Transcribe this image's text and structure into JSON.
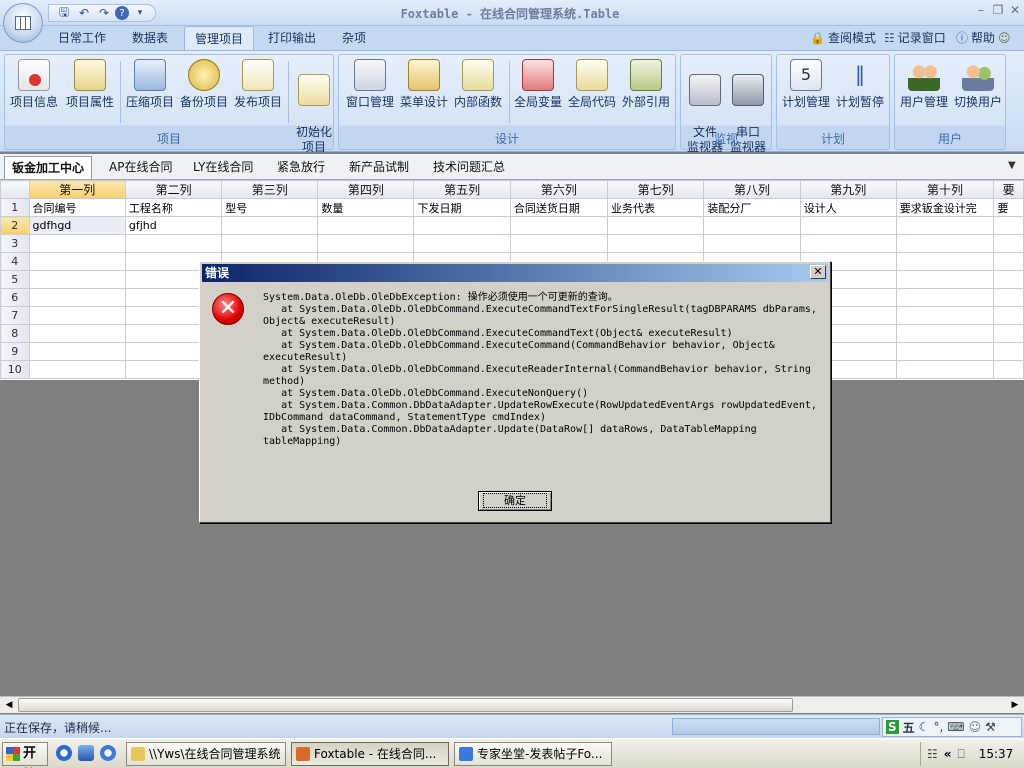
{
  "window": {
    "title": "Foxtable - 在线合同管理系统.Table"
  },
  "qat": {
    "icons": [
      "save-icon",
      "undo-icon",
      "redo-icon",
      "help-icon",
      "dropdown-icon"
    ]
  },
  "tabs": [
    "日常工作",
    "数据表",
    "管理项目",
    "打印输出",
    "杂项"
  ],
  "active_tab": "管理项目",
  "right_links": {
    "view_mode": "查阅模式",
    "log_window": "记录窗口",
    "help": "帮助"
  },
  "ribbon": {
    "groups": [
      {
        "label": "项目",
        "buttons": [
          "项目信息",
          "项目属性",
          "压缩项目",
          "备份项目",
          "发布项目",
          "初始化\n项目"
        ]
      },
      {
        "label": "设计",
        "buttons": [
          "窗口管理",
          "菜单设计",
          "内部函数",
          "全局变量",
          "全局代码",
          "外部引用"
        ]
      },
      {
        "label": "监视",
        "buttons": [
          "文件\n监视器",
          "串口\n监视器"
        ]
      },
      {
        "label": "计划",
        "buttons": [
          "计划管理",
          "计划暂停"
        ]
      },
      {
        "label": "用户",
        "buttons": [
          "用户管理",
          "切换用户"
        ]
      }
    ]
  },
  "doc_tabs": [
    "钣金加工中心",
    "AP在线合同",
    "LY在线合同",
    "紧急放行",
    "新产品试制",
    "技术问题汇总"
  ],
  "active_doc_tab": "钣金加工中心",
  "grid": {
    "columns": [
      "第一列",
      "第二列",
      "第三列",
      "第四列",
      "第五列",
      "第六列",
      "第七列",
      "第八列",
      "第九列",
      "第十列",
      "要"
    ],
    "rows": [
      [
        "合同编号",
        "工程名称",
        "型号",
        "数量",
        "下发日期",
        "合同送货日期",
        "业务代表",
        "装配分厂",
        "设计人",
        "要求钣金设计完",
        "要"
      ],
      [
        "gdfhgd",
        "gfjhd",
        "",
        "",
        "",
        "",
        "",
        "",
        "",
        "",
        ""
      ],
      [
        "",
        "",
        "",
        "",
        "",
        "",
        "",
        "",
        "",
        "",
        ""
      ],
      [
        "",
        "",
        "",
        "",
        "",
        "",
        "",
        "",
        "",
        "",
        ""
      ],
      [
        "",
        "",
        "",
        "",
        "",
        "",
        "",
        "",
        "",
        "",
        ""
      ],
      [
        "",
        "",
        "",
        "",
        "",
        "",
        "",
        "",
        "",
        "",
        ""
      ],
      [
        "",
        "",
        "",
        "",
        "",
        "",
        "",
        "",
        "",
        "",
        ""
      ],
      [
        "",
        "",
        "",
        "",
        "",
        "",
        "",
        "",
        "",
        "",
        ""
      ],
      [
        "",
        "",
        "",
        "",
        "",
        "",
        "",
        "",
        "",
        "",
        ""
      ],
      [
        "",
        "",
        "",
        "",
        "",
        "",
        "",
        "",
        "",
        "",
        ""
      ]
    ],
    "row_numbers": [
      "1",
      "2",
      "3",
      "4",
      "5",
      "6",
      "7",
      "8",
      "9",
      "10"
    ]
  },
  "status": {
    "text": "正在保存，请稍候..."
  },
  "dialog": {
    "title": "错误",
    "message": "System.Data.OleDb.OleDbException: 操作必须使用一个可更新的查询。\n   at System.Data.OleDb.OleDbCommand.ExecuteCommandTextForSingleResult(tagDBPARAMS dbParams, Object& executeResult)\n   at System.Data.OleDb.OleDbCommand.ExecuteCommandText(Object& executeResult)\n   at System.Data.OleDb.OleDbCommand.ExecuteCommand(CommandBehavior behavior, Object& executeResult)\n   at System.Data.OleDb.OleDbCommand.ExecuteReaderInternal(CommandBehavior behavior, String method)\n   at System.Data.OleDb.OleDbCommand.ExecuteNonQuery()\n   at System.Data.Common.DbDataAdapter.UpdateRowExecute(RowUpdatedEventArgs rowUpdatedEvent, IDbCommand dataCommand, StatementType cmdIndex)\n   at System.Data.Common.DbDataAdapter.Update(DataRow[] dataRows, DataTableMapping tableMapping)",
    "ok_label": "确定"
  },
  "taskbar": {
    "start": "开始",
    "items": [
      "\\\\Yws\\在线合同管理系统",
      "Foxtable - 在线合同...",
      "专家坐堂-发表帖子Fo..."
    ],
    "ime": "五",
    "clock": "15:37"
  },
  "colors": {
    "accent": "#0a246a",
    "ribbon": "#c9dcf3",
    "error": "#e00000"
  }
}
